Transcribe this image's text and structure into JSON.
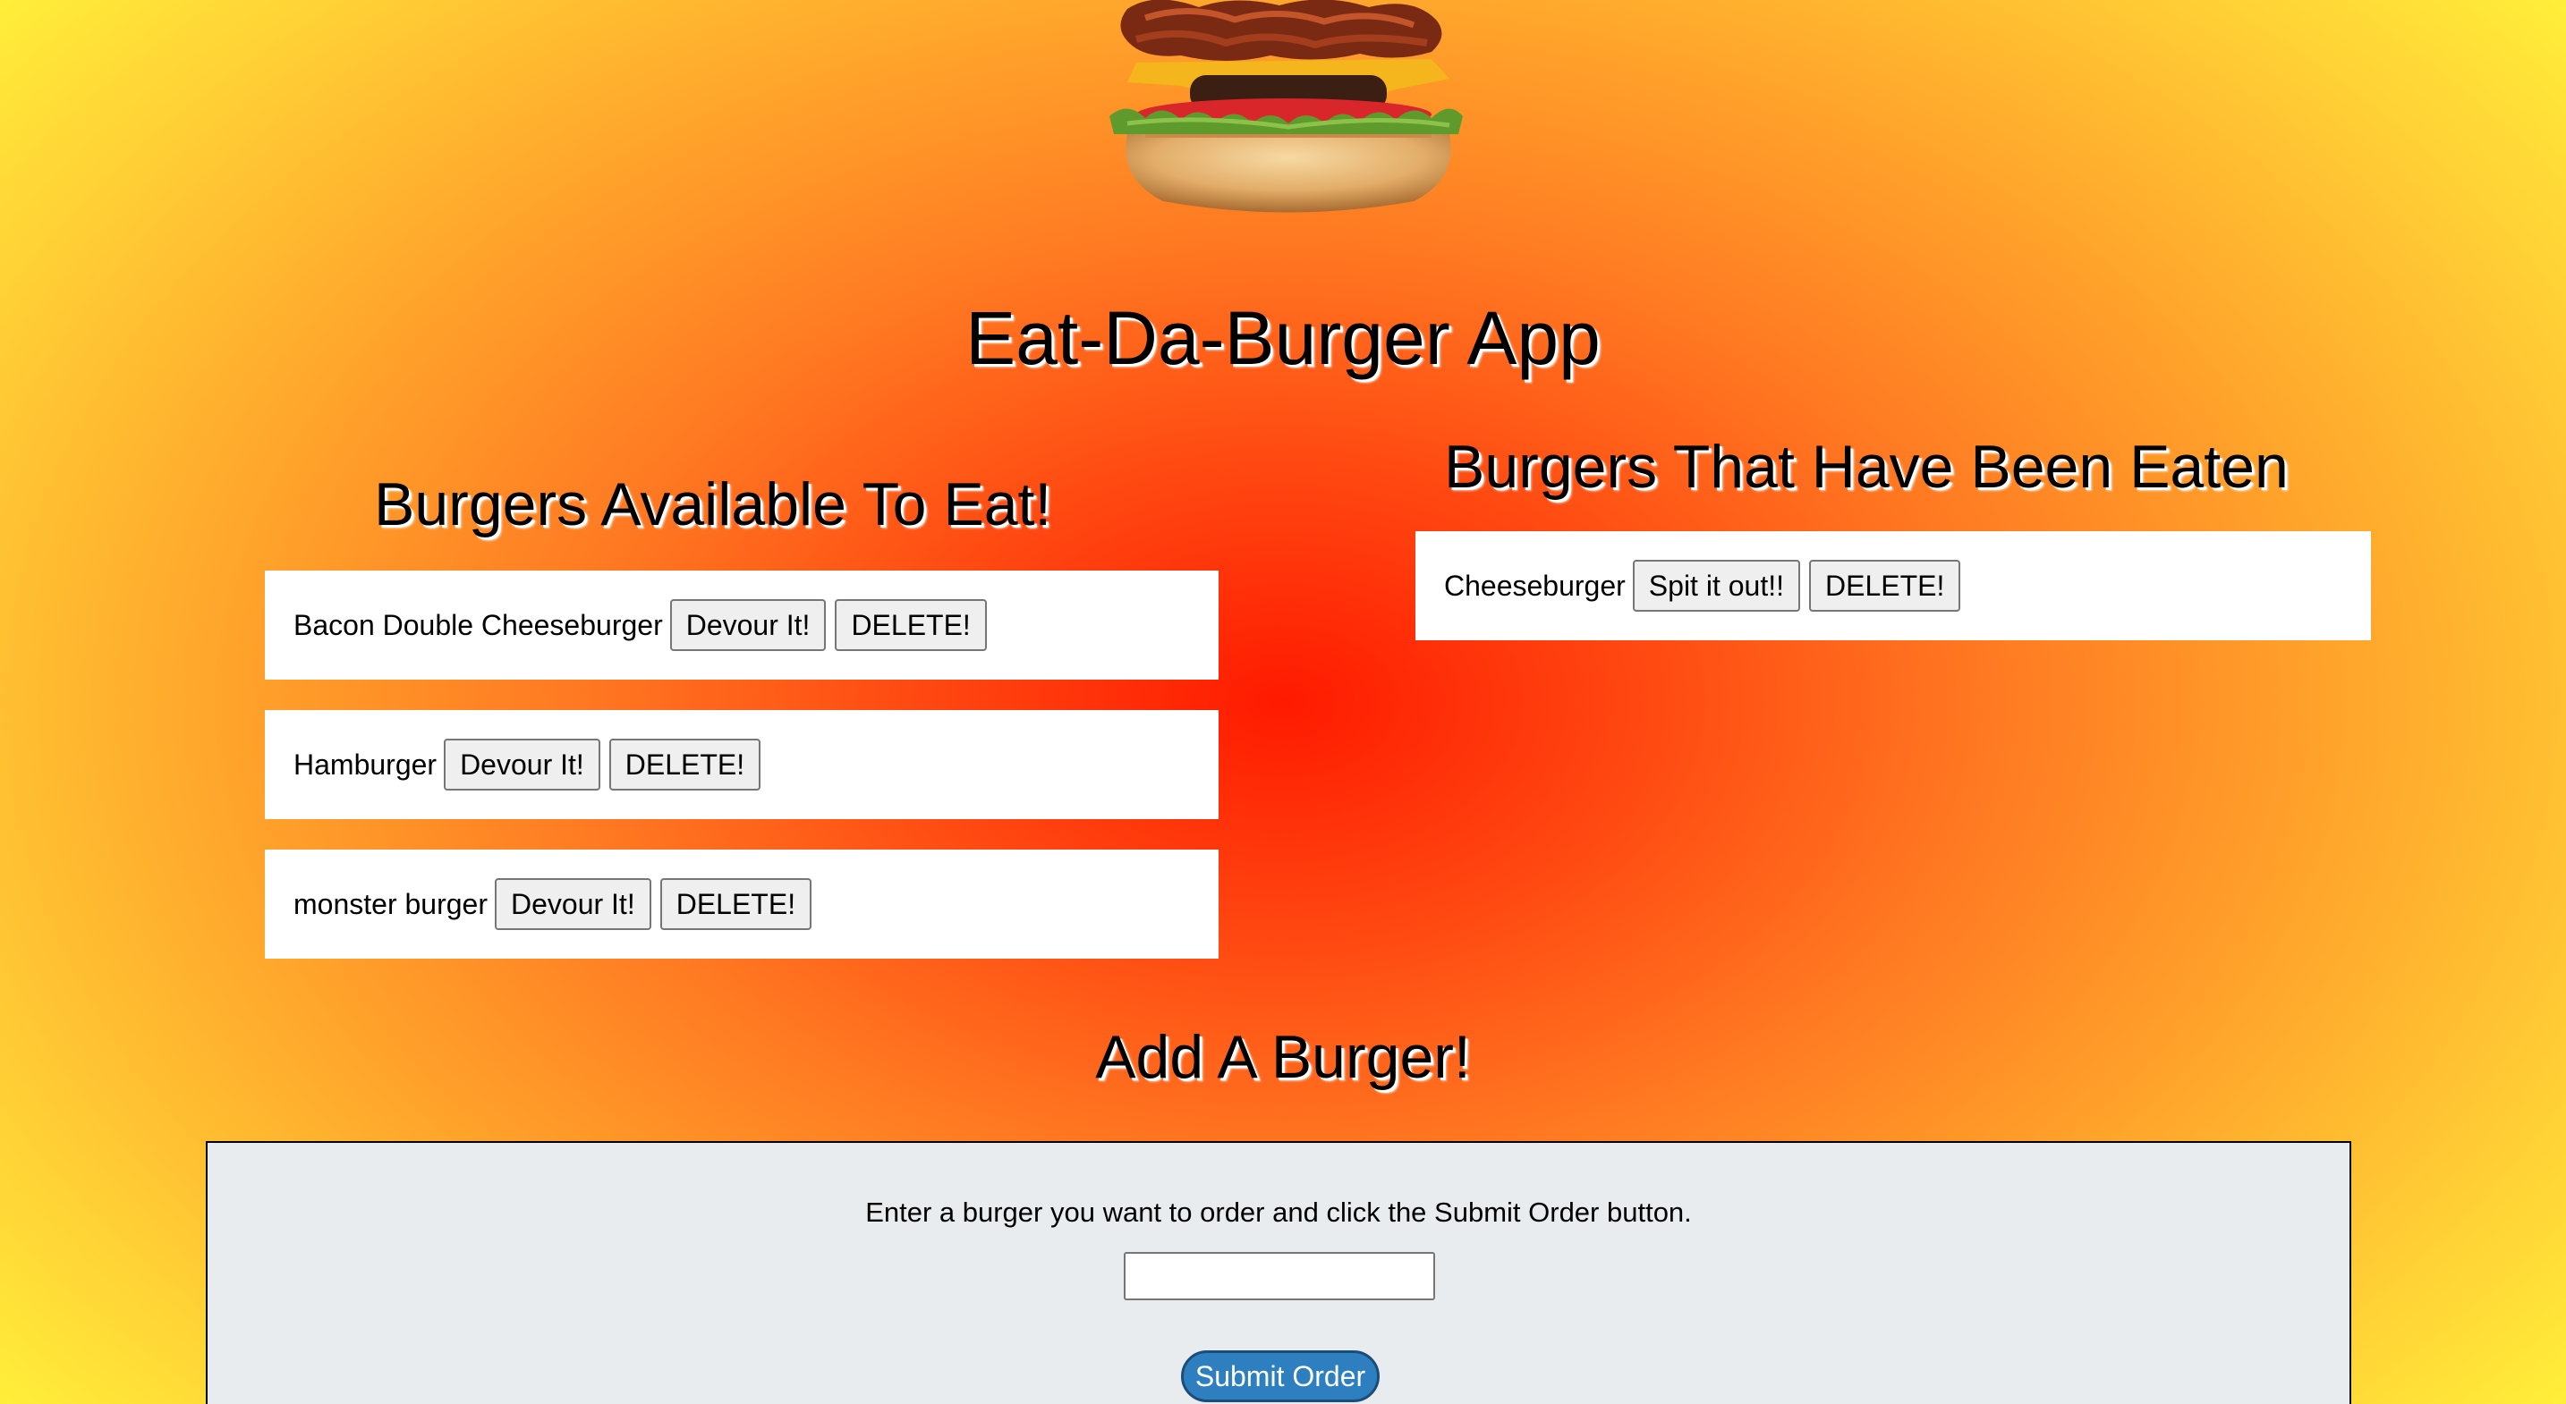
{
  "header": {
    "image_icon": "burger-photo",
    "title": "Eat-Da-Burger App"
  },
  "available": {
    "heading": "Burgers Available To Eat!",
    "items": [
      {
        "name": "Bacon Double Cheeseburger",
        "devour_label": "Devour It!",
        "delete_label": "DELETE!"
      },
      {
        "name": "Hamburger",
        "devour_label": "Devour It!",
        "delete_label": "DELETE!"
      },
      {
        "name": "monster burger",
        "devour_label": "Devour It!",
        "delete_label": "DELETE!"
      }
    ]
  },
  "eaten": {
    "heading": "Burgers That Have Been Eaten",
    "items": [
      {
        "name": "Cheeseburger",
        "spit_label": "Spit it out!!",
        "delete_label": "DELETE!"
      }
    ]
  },
  "add": {
    "heading": "Add A Burger!",
    "instructions": "Enter a burger you want to order and click the Submit Order button.",
    "input_value": "",
    "submit_label": "Submit Order"
  },
  "colors": {
    "background_center": "#ff1a00",
    "background_edge": "#fff23a",
    "panel_bg": "#e9ecef",
    "submit_bg": "#2e7fc0"
  }
}
